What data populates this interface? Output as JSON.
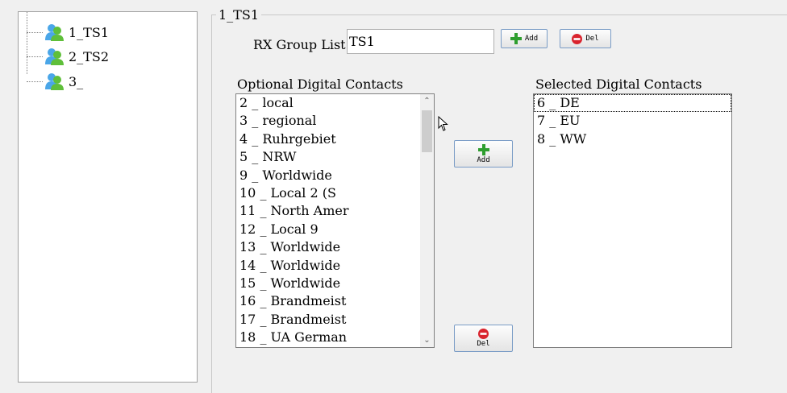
{
  "tree": {
    "items": [
      {
        "label": "1_TS1",
        "icon": "users-icon"
      },
      {
        "label": "2_TS2",
        "icon": "users-icon"
      },
      {
        "label": "3_",
        "icon": "users-icon"
      }
    ]
  },
  "group": {
    "title": "1_TS1",
    "rx_label": "RX Group List",
    "rx_value": "TS1",
    "add_label": "Add",
    "del_label": "Del"
  },
  "optional": {
    "header": "Optional Digital Contacts",
    "items": [
      "2 _ local",
      "3 _ regional",
      "4 _ Ruhrgebiet",
      "5 _ NRW",
      "9 _ Worldwide",
      "10 _ Local 2 (S",
      "11 _ North Amer",
      "12 _ Local 9",
      "13 _ Worldwide",
      "14 _ Worldwide",
      "15 _ Worldwide",
      "16 _ Brandmeist",
      "17 _ Brandmeist",
      "18 _ UA German"
    ]
  },
  "selected": {
    "header": "Selected Digital Contacts",
    "items": [
      "6 _ DE",
      "7 _ EU",
      "8 _ WW"
    ]
  },
  "transfer": {
    "add_label": "Add",
    "del_label": "Del"
  },
  "colors": {
    "add_icon": "#2e9e2e",
    "del_icon": "#d9232d",
    "button_border": "#7a9cc6"
  }
}
